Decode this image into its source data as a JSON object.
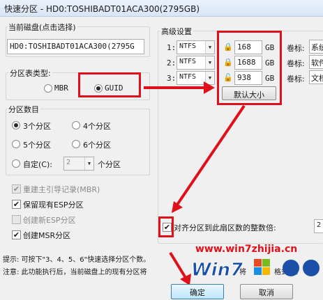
{
  "window": {
    "title": "快速分区 - HD0:TOSHIBADT01ACA300(2795GB)"
  },
  "disk": {
    "legend": "当前磁盘(点击选择)",
    "value": "HD0:TOSHIBADT01ACA300(2795G"
  },
  "partition_table": {
    "legend": "分区表类型:",
    "options": [
      "MBR",
      "GUID"
    ],
    "selected": "GUID"
  },
  "partition_count": {
    "legend": "分区数目",
    "options": [
      "3个分区",
      "4个分区",
      "5个分区",
      "6个分区"
    ],
    "selected": "3个分区",
    "custom_label": "自定(C):",
    "custom_value": "2",
    "custom_suffix": "个分区"
  },
  "checkboxes": [
    {
      "label": "重建主引导记录(MBR)",
      "checked": true,
      "enabled": false
    },
    {
      "label": "保留现有ESP分区",
      "checked": true,
      "enabled": true
    },
    {
      "label": "创建新ESP分区",
      "checked": false,
      "enabled": false
    },
    {
      "label": "创建MSR分区",
      "checked": true,
      "enabled": true
    }
  ],
  "advanced": {
    "legend": "高级设置",
    "rows": [
      {
        "index": "1:",
        "fs": "NTFS",
        "size": "168",
        "unit": "GB",
        "vol_label": "卷标:",
        "vol_value": "系统",
        "locked": true
      },
      {
        "index": "2:",
        "fs": "NTFS",
        "size": "1688",
        "unit": "GB",
        "vol_label": "卷标:",
        "vol_value": "软件",
        "locked": true
      },
      {
        "index": "3:",
        "fs": "NTFS",
        "size": "938",
        "unit": "GB",
        "vol_label": "卷标:",
        "vol_value": "文档",
        "locked": false
      }
    ],
    "default_size_button": "默认大小",
    "align_label": "对齐分区到此扇区数的整数倍:",
    "align_value": "2"
  },
  "hints": {
    "line1": "提示: 可按下\"3、4、5、6\"快速选择分区个数。",
    "line2": "注意: 此功能执行后，当前磁盘上的现有分区将",
    "line2b": "将",
    "line2c": "格式化。"
  },
  "watermark": {
    "url": "www.win7zhijia.cn"
  },
  "buttons": {
    "ok": "确定",
    "cancel": "取消"
  }
}
